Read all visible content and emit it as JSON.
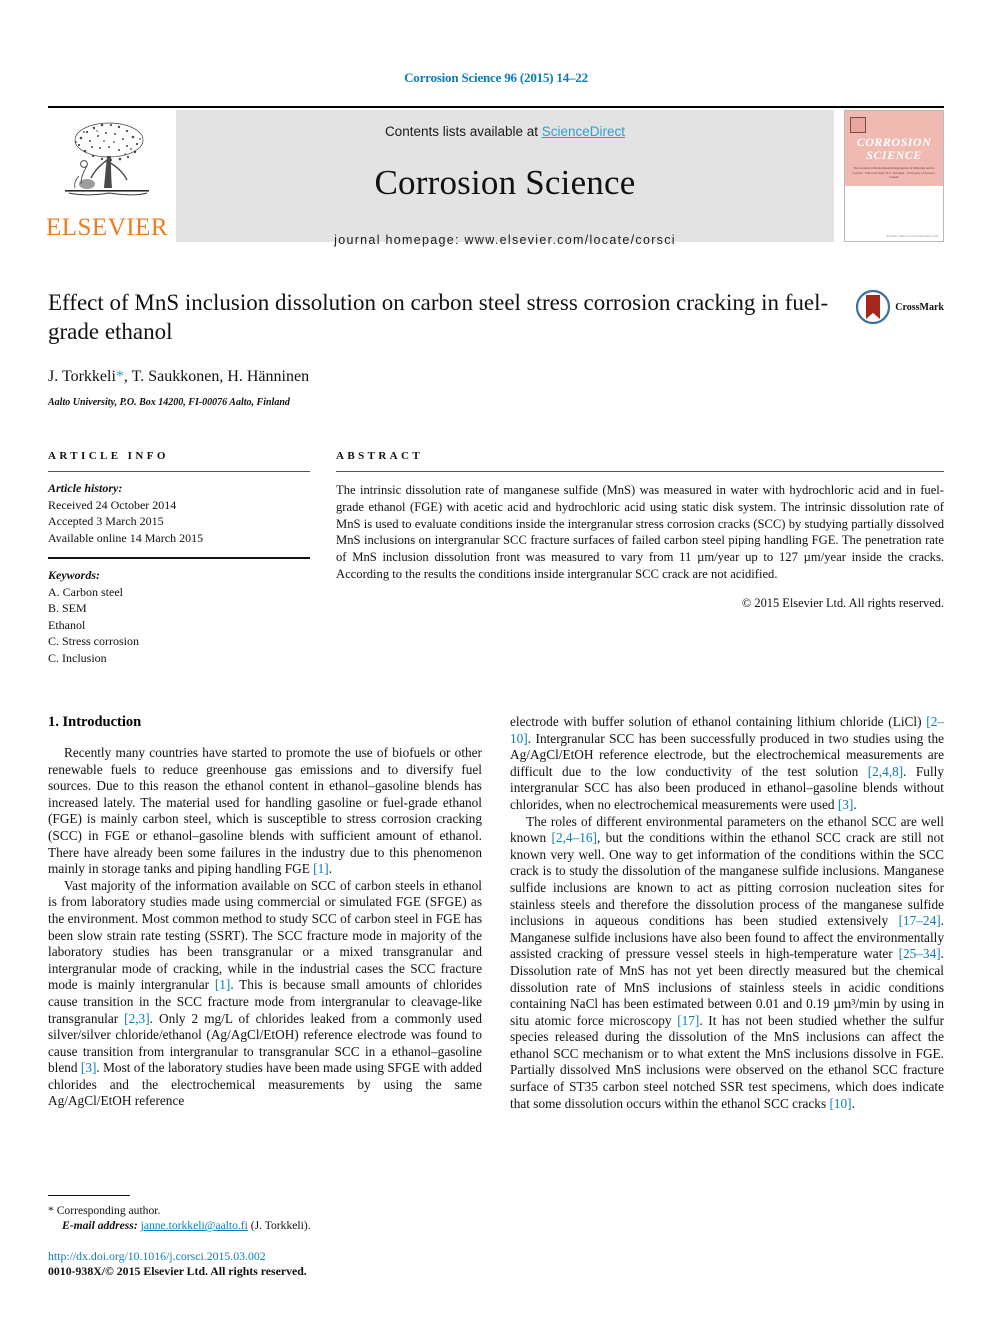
{
  "running_head": "Corrosion Science 96 (2015) 14–22",
  "masthead": {
    "contents_prefix": "Contents lists available at ",
    "sciencedirect": "ScienceDirect",
    "journal_title": "Corrosion Science",
    "journal_homepage": "journal homepage: www.elsevier.com/locate/corsci",
    "publisher_name": "ELSEVIER",
    "cover": {
      "line1": "CORROSION",
      "line2": "SCIENCE",
      "subtitle": "The Journal on Environmental Degradation of Materials and its Control · Editor-in-Chief: R.C. Newman · University of Toronto, Canada",
      "footer": "Available online at www.sciencedirect.com"
    },
    "colors": {
      "link": "#2f9fd0",
      "running_head": "#0b7db5",
      "elsevier_orange": "#ef7d19",
      "masthead_bg": "#e3e3e3",
      "cover_pink": "#f0b9b2"
    }
  },
  "article": {
    "title": "Effect of MnS inclusion dissolution on carbon steel stress corrosion cracking in fuel-grade ethanol",
    "crossmark_label": "CrossMark",
    "authors": "J. Torkkeli",
    "authors_rest": ", T. Saukkonen, H. Hänninen",
    "corresponding_marker": "*",
    "affiliation": "Aalto University, P.O. Box 14200, FI-00076 Aalto, Finland"
  },
  "article_info": {
    "heading": "ARTICLE INFO",
    "history_label": "Article history:",
    "history": [
      "Received 24 October 2014",
      "Accepted 3 March 2015",
      "Available online 14 March 2015"
    ],
    "keywords_label": "Keywords:",
    "keywords": [
      "A. Carbon steel",
      "B. SEM",
      "Ethanol",
      "C. Stress corrosion",
      "C. Inclusion"
    ]
  },
  "abstract": {
    "heading": "ABSTRACT",
    "text": "The intrinsic dissolution rate of manganese sulfide (MnS) was measured in water with hydrochloric acid and in fuel-grade ethanol (FGE) with acetic acid and hydrochloric acid using static disk system. The intrinsic dissolution rate of MnS is used to evaluate conditions inside the intergranular stress corrosion cracks (SCC) by studying partially dissolved MnS inclusions on intergranular SCC fracture surfaces of failed carbon steel piping handling FGE. The penetration rate of MnS inclusion dissolution front was measured to vary from 11 µm/year up to 127 µm/year inside the cracks. According to the results the conditions inside intergranular SCC crack are not acidified.",
    "copyright": "© 2015 Elsevier Ltd. All rights reserved."
  },
  "body": {
    "section_number_title": "1. Introduction",
    "left_paragraphs": [
      "Recently many countries have started to promote the use of biofuels or other renewable fuels to reduce greenhouse gas emissions and to diversify fuel sources. Due to this reason the ethanol content in ethanol–gasoline blends has increased lately. The material used for handling gasoline or fuel-grade ethanol (FGE) is mainly carbon steel, which is susceptible to stress corrosion cracking (SCC) in FGE or ethanol–gasoline blends with sufficient amount of ethanol. There have already been some failures in the industry due to this phenomenon mainly in storage tanks and piping handling FGE [1].",
      "Vast majority of the information available on SCC of carbon steels in ethanol is from laboratory studies made using commercial or simulated FGE (SFGE) as the environment. Most common method to study SCC of carbon steel in FGE has been slow strain rate testing (SSRT). The SCC fracture mode in majority of the laboratory studies has been transgranular or a mixed transgranular and intergranular mode of cracking, while in the industrial cases the SCC fracture mode is mainly intergranular [1]. This is because small amounts of chlorides cause transition in the SCC fracture mode from intergranular to cleavage-like transgranular [2,3]. Only 2 mg/L of chlorides leaked from a commonly used silver/silver chloride/ethanol (Ag/AgCl/EtOH) reference electrode was found to cause transition from intergranular to transgranular SCC in a ethanol–gasoline blend [3]. Most of the laboratory studies have been made using SFGE with added chlorides and the electrochemical measurements by using the same Ag/AgCl/EtOH reference"
    ],
    "right_paragraphs": [
      "electrode with buffer solution of ethanol containing lithium chloride (LiCl) [2–10]. Intergranular SCC has been successfully produced in two studies using the Ag/AgCl/EtOH reference electrode, but the electrochemical measurements are difficult due to the low conductivity of the test solution [2,4,8]. Fully intergranular SCC has also been produced in ethanol–gasoline blends without chlorides, when no electrochemical measurements were used [3].",
      "The roles of different environmental parameters on the ethanol SCC are well known [2,4–16], but the conditions within the ethanol SCC crack are still not known very well. One way to get information of the conditions within the SCC crack is to study the dissolution of the manganese sulfide inclusions. Manganese sulfide inclusions are known to act as pitting corrosion nucleation sites for stainless steels and therefore the dissolution process of the manganese sulfide inclusions in aqueous conditions has been studied extensively [17–24]. Manganese sulfide inclusions have also been found to affect the environmentally assisted cracking of pressure vessel steels in high-temperature water [25–34]. Dissolution rate of MnS has not yet been directly measured but the chemical dissolution rate of MnS inclusions of stainless steels in acidic conditions containing NaCl has been estimated between 0.01 and 0.19 µm³/min by using in situ atomic force microscopy [17]. It has not been studied whether the sulfur species released during the dissolution of the MnS inclusions can affect the ethanol SCC mechanism or to what extent the MnS inclusions dissolve in FGE. Partially dissolved MnS inclusions were observed on the ethanol SCC fracture surface of ST35 carbon steel notched SSR test specimens, which does indicate that some dissolution occurs within the ethanol SCC cracks [10]."
    ]
  },
  "footer": {
    "corresponding_marker": "*",
    "corresponding_text": "Corresponding author.",
    "email_label": "E-mail address:",
    "email": "janne.torkkeli@aalto.fi",
    "email_owner": "(J. Torkkeli).",
    "doi": "http://dx.doi.org/10.1016/j.corsci.2015.03.002",
    "issn_copyright": "0010-938X/© 2015 Elsevier Ltd. All rights reserved."
  }
}
